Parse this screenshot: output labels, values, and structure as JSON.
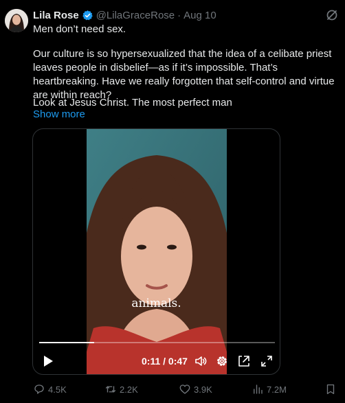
{
  "author": {
    "display_name": "Lila Rose",
    "handle": "@LilaGraceRose",
    "separator": "·",
    "date": "Aug 10",
    "verified": true
  },
  "tweet": {
    "line1": "Men don’t need sex.",
    "paragraph2": "Our culture is so hypersexualized that the idea of a celibate priest leaves people in disbelief—as if it’s impossible. That’s heartbreaking. Have we really forgotten that self-control and virtue are within reach?",
    "paragraph3": "Look at Jesus Christ. The most perfect man",
    "show_more": "Show more"
  },
  "video": {
    "caption": "animals.",
    "time": "0:11 / 0:47",
    "progress_fraction": 0.234
  },
  "actions": {
    "replies": "4.5K",
    "reposts": "2.2K",
    "likes": "3.9K",
    "views": "7.2M"
  },
  "colors": {
    "background": "#000000",
    "text": "#e7e9ea",
    "muted": "#71767b",
    "link": "#1d9bf0",
    "verified": "#1d9bf0"
  },
  "icons": [
    "verified-badge-icon",
    "grok-icon",
    "play-icon",
    "volume-icon",
    "settings-gear-icon",
    "picture-in-picture-icon",
    "fullscreen-icon",
    "reply-icon",
    "repost-icon",
    "like-icon",
    "views-icon",
    "bookmark-icon"
  ]
}
